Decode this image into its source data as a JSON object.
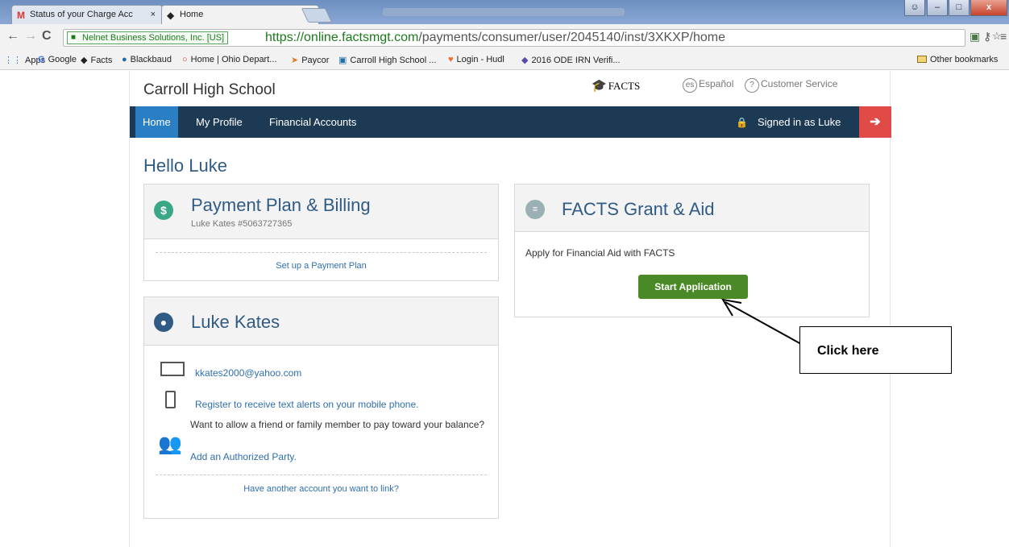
{
  "browser": {
    "tabs": [
      {
        "title": "Status of your Charge Acc",
        "icon": "gmail-icon"
      },
      {
        "title": "Home",
        "icon": "graduation-cap-icon"
      }
    ],
    "close_glyph": "×",
    "address": {
      "security_label": "Nelnet Business Solutions, Inc. [US]",
      "url_host": "https://online.factsmgt.com",
      "url_path": "/payments/consumer/user/2045140/inst/3XKXP/home"
    },
    "bookmarks": [
      {
        "label": "Apps",
        "icon": "apps-grid-icon"
      },
      {
        "label": "Google",
        "icon": "google-icon"
      },
      {
        "label": "Facts",
        "icon": "graduation-cap-icon"
      },
      {
        "label": "Blackbaud",
        "icon": "blackbaud-icon"
      },
      {
        "label": "Home | Ohio Depart...",
        "icon": "ohio-icon"
      },
      {
        "label": "Paycor",
        "icon": "paycor-icon"
      },
      {
        "label": "Carroll High School ...",
        "icon": "school-icon"
      },
      {
        "label": "Login - Hudl",
        "icon": "hudl-icon"
      },
      {
        "label": "2016 ODE IRN Verifi...",
        "icon": "ode-icon"
      }
    ],
    "other_bookmarks": "Other bookmarks"
  },
  "header": {
    "school_name": "Carroll High School",
    "logo_text": "FACTS",
    "lang_abbr": "es",
    "language_link": "Español",
    "help_glyph": "?",
    "customer_service": "Customer Service"
  },
  "nav": {
    "items": [
      "Home",
      "My Profile",
      "Financial Accounts"
    ],
    "signed_in": "Signed in as Luke"
  },
  "greeting": "Hello Luke",
  "payment_card": {
    "icon_glyph": "$",
    "title": "Payment Plan & Billing",
    "subtitle": "Luke Kates #5063727365",
    "link": "Set up a Payment Plan"
  },
  "profile_card": {
    "title": "Luke Kates",
    "email": "kkates2000@yahoo.com",
    "text_alerts": "Register to receive text alerts on your mobile phone.",
    "authorized_prompt": "Want to allow a friend or family member to pay toward your balance?",
    "authorized_link": "Add an Authorized Party.",
    "link_account": "Have another account you want to link?"
  },
  "grant_card": {
    "title": "FACTS Grant & Aid",
    "description": "Apply for Financial Aid with FACTS",
    "button": "Start Application"
  },
  "annotation": {
    "callout": "Click here"
  },
  "colors": {
    "navbar": "#1d3a55",
    "nav_active": "#2a7ec3",
    "signout": "#e04b48",
    "primary_text": "#2f5b84",
    "button_green": "#4a8a26",
    "payment_icon": "#3aa886",
    "grant_icon": "#9bb0b4",
    "profile_icon": "#2f5b84"
  }
}
